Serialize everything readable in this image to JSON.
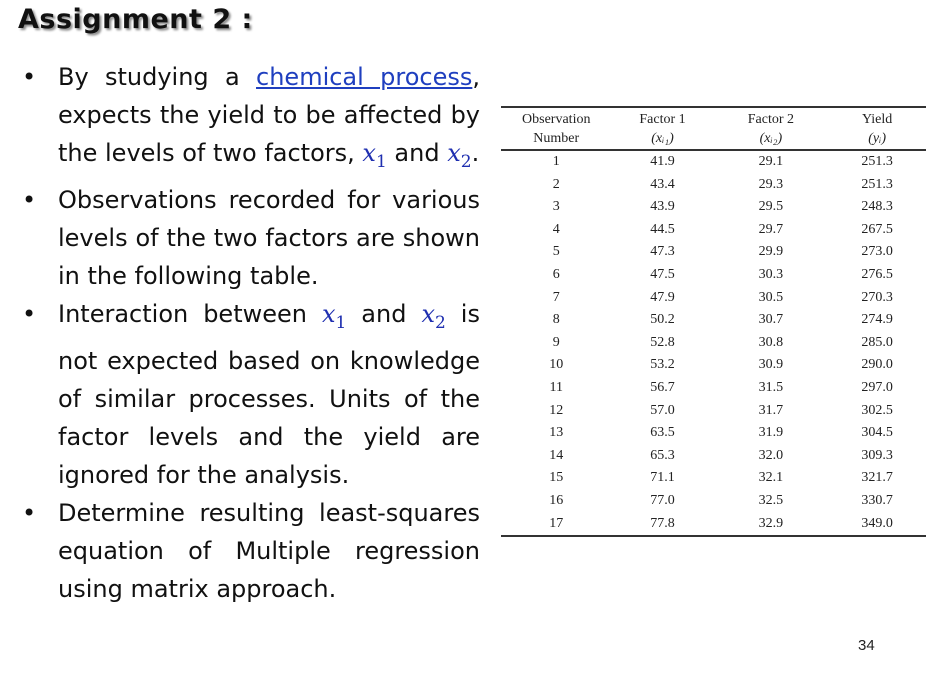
{
  "slide": {
    "title": "Assignment 2 :",
    "page_number": "34",
    "link_color": "#1f3fbf",
    "math_color": "#1f2fb0"
  },
  "bullets": [
    {
      "parts": [
        {
          "text": "By studying a "
        },
        {
          "text": "chemical process",
          "link": true
        },
        {
          "text": ", expects the yield to be affected by the levels of two factors, "
        },
        {
          "math": "x",
          "sub": "1"
        },
        {
          "text": " and "
        },
        {
          "math": "x",
          "sub": "2"
        },
        {
          "text": "."
        }
      ]
    },
    {
      "parts": [
        {
          "text": "Observations recorded for various levels of the two factors are shown in the following table."
        }
      ]
    },
    {
      "parts": [
        {
          "text": "Interaction between "
        },
        {
          "math": "x",
          "sub": "1"
        },
        {
          "text": " and "
        },
        {
          "math": "x",
          "sub": "2"
        },
        {
          "text": " is not expected based on knowledge of similar processes. Units of the factor levels and the yield are ignored for the analysis."
        }
      ]
    },
    {
      "parts": [
        {
          "text": "Determine resulting least-squares equation of Multiple regression using matrix approach."
        }
      ]
    }
  ],
  "table": {
    "headers": [
      {
        "line1": "Observation",
        "line2": "Number",
        "sym": ""
      },
      {
        "line1": "Factor 1",
        "line2": "",
        "sym": "(xᵢ₁)"
      },
      {
        "line1": "Factor 2",
        "line2": "",
        "sym": "(xᵢ₂)"
      },
      {
        "line1": "Yield",
        "line2": "",
        "sym": "(yᵢ)"
      }
    ],
    "rows": [
      [
        "1",
        "41.9",
        "29.1",
        "251.3"
      ],
      [
        "2",
        "43.4",
        "29.3",
        "251.3"
      ],
      [
        "3",
        "43.9",
        "29.5",
        "248.3"
      ],
      [
        "4",
        "44.5",
        "29.7",
        "267.5"
      ],
      [
        "5",
        "47.3",
        "29.9",
        "273.0"
      ],
      [
        "6",
        "47.5",
        "30.3",
        "276.5"
      ],
      [
        "7",
        "47.9",
        "30.5",
        "270.3"
      ],
      [
        "8",
        "50.2",
        "30.7",
        "274.9"
      ],
      [
        "9",
        "52.8",
        "30.8",
        "285.0"
      ],
      [
        "10",
        "53.2",
        "30.9",
        "290.0"
      ],
      [
        "11",
        "56.7",
        "31.5",
        "297.0"
      ],
      [
        "12",
        "57.0",
        "31.7",
        "302.5"
      ],
      [
        "13",
        "63.5",
        "31.9",
        "304.5"
      ],
      [
        "14",
        "65.3",
        "32.0",
        "309.3"
      ],
      [
        "15",
        "71.1",
        "32.1",
        "321.7"
      ],
      [
        "16",
        "77.0",
        "32.5",
        "330.7"
      ],
      [
        "17",
        "77.8",
        "32.9",
        "349.0"
      ]
    ]
  }
}
